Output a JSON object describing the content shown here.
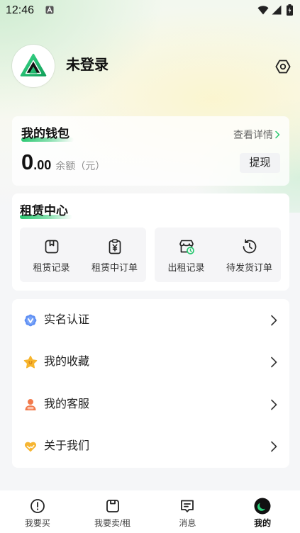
{
  "status_bar": {
    "time": "12:46",
    "notification_icon": "app-notification-icon",
    "wifi_icon": "wifi-icon",
    "signal_icon": "cellular-signal-icon",
    "battery_icon": "battery-charging-icon"
  },
  "profile": {
    "avatar_icon": "app-logo-icon",
    "name": "未登录",
    "settings_icon": "settings-icon"
  },
  "wallet": {
    "title": "我的钱包",
    "detail_link": "查看详情",
    "detail_icon": "chevron-right-icon",
    "balance_integer": "0",
    "balance_decimal": ".00",
    "balance_label": "余额（元）",
    "withdraw_button": "提现"
  },
  "rental_center": {
    "title": "租赁中心",
    "groups": [
      {
        "items": [
          {
            "label": "租赁记录",
            "icon": "rental-record-icon"
          },
          {
            "label": "租赁中订单",
            "icon": "yuan-clipboard-icon"
          }
        ]
      },
      {
        "items": [
          {
            "label": "出租记录",
            "icon": "shop-clock-icon"
          },
          {
            "label": "待发货订单",
            "icon": "pending-shipment-clock-icon"
          }
        ]
      }
    ]
  },
  "menu": {
    "items": [
      {
        "label": "实名认证",
        "icon": "verified-badge-icon"
      },
      {
        "label": "我的收藏",
        "icon": "star-icon"
      },
      {
        "label": "我的客服",
        "icon": "customer-service-icon"
      },
      {
        "label": "关于我们",
        "icon": "heart-handshake-icon"
      }
    ],
    "row_icon": "chevron-right-icon"
  },
  "tab_bar": {
    "tabs": [
      {
        "label": "我要买",
        "icon": "buy-icon",
        "active": false
      },
      {
        "label": "我要卖/租",
        "icon": "sell-rent-icon",
        "active": false
      },
      {
        "label": "消息",
        "icon": "message-icon",
        "active": false
      },
      {
        "label": "我的",
        "icon": "profile-icon",
        "active": true
      }
    ]
  },
  "colors": {
    "accent": "#2bc872",
    "text_primary": "#1a1a1a",
    "text_secondary": "#666666",
    "page_background": "#f5f6f8",
    "card_background": "#ffffff",
    "verified_blue": "#5e8ff4",
    "star_yellow": "#f7b52c",
    "service_orange": "#f27a4c",
    "about_yellow": "#f6b532"
  }
}
